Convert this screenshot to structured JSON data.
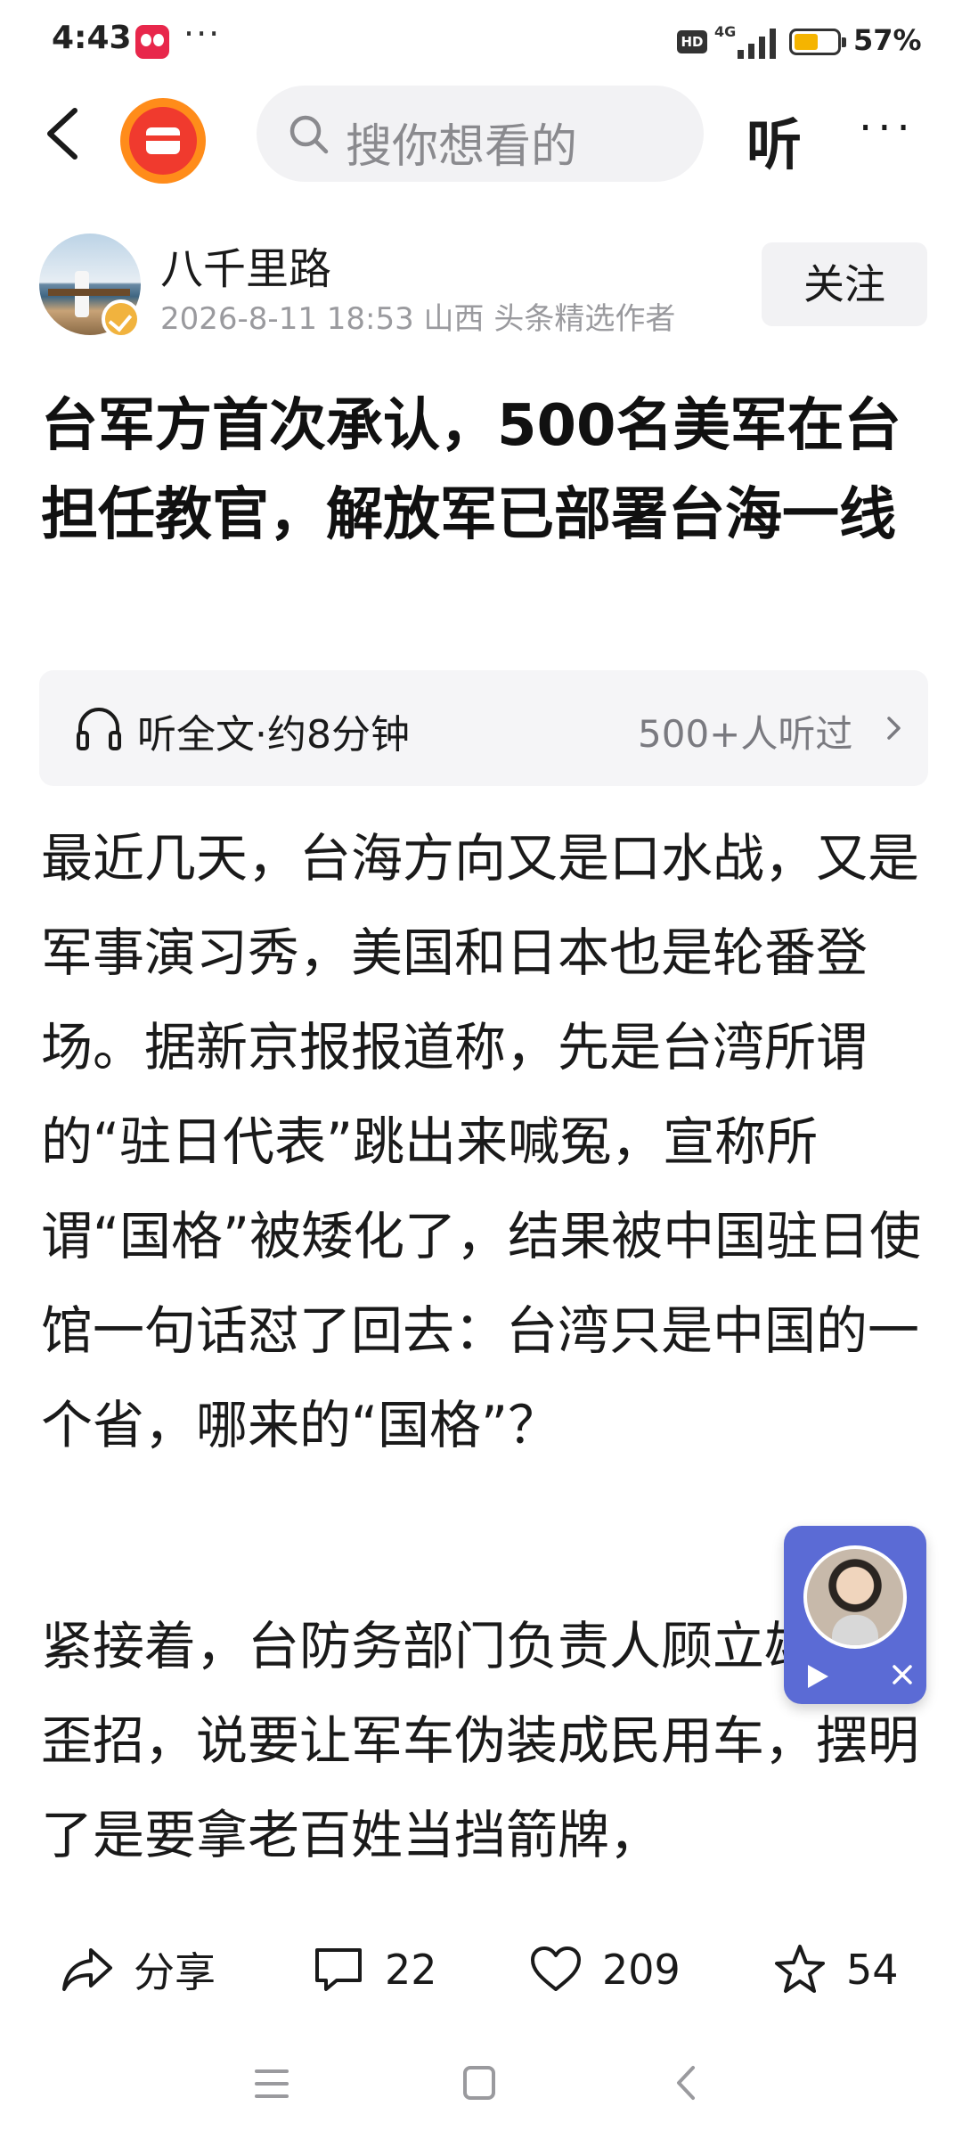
{
  "status_bar": {
    "time": "4:43",
    "dots": "···",
    "hd": "HD",
    "network": "4G",
    "battery_percent": 57,
    "battery_text": "57%",
    "battery_color": "#f5b400"
  },
  "nav": {
    "search_placeholder": "搜你想看的",
    "listen_label": "听",
    "more_label": "···",
    "logo_colors": {
      "outer": "#ff8c1a",
      "inner": "#f03a2e"
    }
  },
  "author": {
    "name": "八千里路",
    "meta": "2026-8-11  18:53  山西  头条精选作者",
    "follow_label": "关注"
  },
  "article": {
    "title": "台军方首次承认，500名美军在台担任教官，解放军已部署台海一线",
    "listen_full": "听全文·约8分钟",
    "listen_count": "500+人听过",
    "paragraphs": [
      "最近几天，台海方向又是口水战，又是军事演习秀，美国和日本也是轮番登场。据新京报报道称，先是台湾所谓的“驻日代表”跳出来喊冤，宣称所谓“国格”被矮化了，结果被中国驻日使馆一句话怼了回去：台湾只是中国的一个省，哪来的“国格”？",
      "紧接着，台防务部门负责人顾立雄又出歪招，说要让军车伪装成民用车，摆明了是要拿老百姓当挡箭牌，"
    ]
  },
  "actions": {
    "share_label": "分享",
    "comment_count": "22",
    "like_count": "209",
    "favorite_count": "54"
  },
  "float_widget": {
    "background": "#5b6bd5"
  },
  "icons": [
    "back-icon",
    "search-icon",
    "headphone-icon",
    "chevron-right-icon",
    "share-icon",
    "comment-icon",
    "heart-icon",
    "star-icon",
    "play-icon",
    "close-icon",
    "menu-icon",
    "home-icon",
    "nav-back-icon"
  ]
}
